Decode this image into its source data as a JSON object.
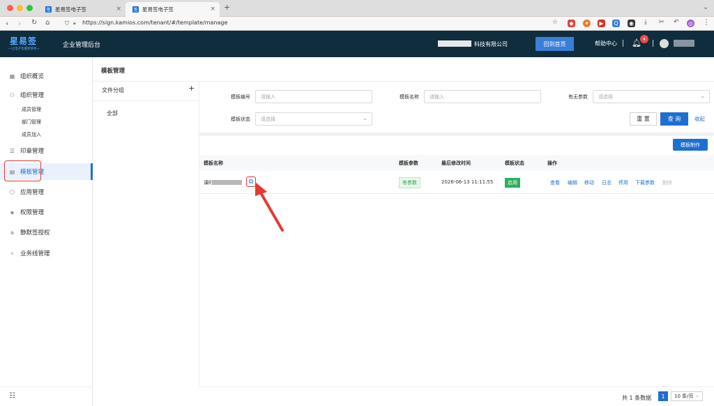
{
  "browser": {
    "tabs": [
      {
        "title": "星易签电子签",
        "favicon": "签"
      },
      {
        "title": "星易签电子签",
        "favicon": "签"
      }
    ],
    "url": "https://sign.kamios.com/tenant/#/template/manage",
    "ellipsis": "⋮"
  },
  "header": {
    "logo": "星易签",
    "logo_sub": "一让电子签署更简单一",
    "admin_title": "企业管理后台",
    "company": "科技有限公司",
    "home_button": "回到首页",
    "help": "帮助中心",
    "notify_count": "4"
  },
  "sidebar": {
    "items": [
      {
        "label": "组织概览",
        "icon": "grid-icon"
      },
      {
        "label": "组织管理",
        "icon": "org-icon"
      },
      {
        "label": "印章管理",
        "icon": "seal-icon"
      },
      {
        "label": "模板管理",
        "icon": "template-icon"
      },
      {
        "label": "应用管理",
        "icon": "cube-icon"
      },
      {
        "label": "权限管理",
        "icon": "permission-icon"
      },
      {
        "label": "静默签授权",
        "icon": "auth-icon"
      },
      {
        "label": "业务线管理",
        "icon": "branch-icon"
      }
    ],
    "sub_items": [
      "成员管理",
      "部门管理",
      "成员加入"
    ]
  },
  "page": {
    "title": "模板管理",
    "folder_title": "文件分组",
    "folder_all": "全部"
  },
  "filters": {
    "code_label": "模板编号",
    "code_placeholder": "请输入",
    "name_label": "模板名称",
    "name_placeholder": "请输入",
    "param_label": "有无参数",
    "param_placeholder": "请选择",
    "status_label": "模板状态",
    "status_placeholder": "请选择",
    "reset": "重 置",
    "query": "查 询",
    "collapse": "收起"
  },
  "toolbar": {
    "make_template": "模板制作"
  },
  "table": {
    "headers": [
      "模板名称",
      "模板参数",
      "最后修改时间",
      "模板状态",
      "操作"
    ],
    "rows": [
      {
        "name": "课时",
        "param": "有参数",
        "modified": "2026-06-13 11:11:55",
        "status": "启用",
        "actions": [
          "查看",
          "编辑",
          "移动",
          "日志",
          "停用",
          "下载参数",
          "删除"
        ]
      }
    ]
  },
  "pagination": {
    "total": "共 1 条数据",
    "page": "1",
    "page_size": "10 条/页"
  }
}
